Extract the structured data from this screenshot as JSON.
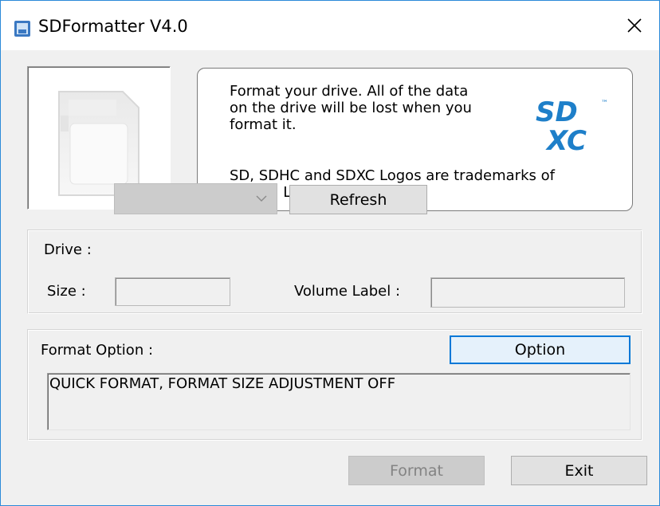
{
  "window": {
    "title": "SDFormatter V4.0",
    "close_icon": "close-icon",
    "accent_color": "#2b8ad9"
  },
  "info": {
    "text_primary": "Format your drive. All of the data\non the drive will be lost when you\nformat it.",
    "text_trademark": "SD, SDHC and SDXC Logos are trademarks of\nSD-3C, LLC.",
    "logo_top": "SD",
    "logo_bottom": "XC",
    "logo_tm": "™",
    "logo_color": "#1e7fc9"
  },
  "drive": {
    "drive_label": "Drive :",
    "drive_value": "",
    "refresh_label": "Refresh",
    "size_label": "Size  :",
    "size_value": "",
    "volume_label": "Volume Label  :",
    "volume_value": ""
  },
  "format_option": {
    "label": "Format Option :",
    "option_button": "Option",
    "current_setting": "QUICK FORMAT, FORMAT SIZE ADJUSTMENT OFF"
  },
  "actions": {
    "format_label": "Format",
    "exit_label": "Exit"
  }
}
